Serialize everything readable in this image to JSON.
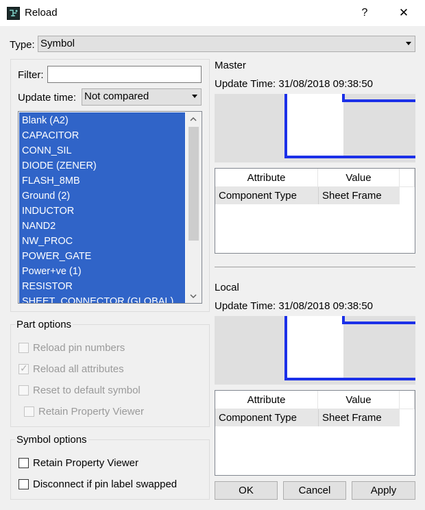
{
  "window": {
    "title": "Reload",
    "help": "?",
    "close": "✕"
  },
  "type": {
    "label": "Type:",
    "value": "Symbol"
  },
  "filter": {
    "label": "Filter:",
    "value": ""
  },
  "update_time": {
    "label": "Update time:",
    "value": "Not compared"
  },
  "symbols": [
    "Blank (A2)",
    "CAPACITOR",
    "CONN_SIL",
    "DIODE (ZENER)",
    "FLASH_8MB",
    "Ground (2)",
    "INDUCTOR",
    "NAND2",
    "NW_PROC",
    "POWER_GATE",
    "Power+ve (1)",
    "RESISTOR",
    "SHEET_CONNECTOR (GLOBAL)"
  ],
  "part_options": {
    "title": "Part options",
    "reload_pin_numbers": "Reload pin numbers",
    "reload_all_attributes": "Reload all attributes",
    "reset_default_symbol": "Reset to default symbol",
    "retain_property_viewer": "Retain Property Viewer"
  },
  "symbol_options": {
    "title": "Symbol options",
    "retain_property_viewer": "Retain Property Viewer",
    "disconnect_pin_label": "Disconnect if pin label swapped"
  },
  "master": {
    "heading": "Master",
    "update_time": "Update Time: 31/08/2018 09:38:50",
    "columns": [
      "Attribute",
      "Value"
    ],
    "rows": [
      {
        "attribute": "Component Type",
        "value": "Sheet Frame"
      }
    ]
  },
  "local": {
    "heading": "Local",
    "update_time": "Update Time: 31/08/2018 09:38:50",
    "columns": [
      "Attribute",
      "Value"
    ],
    "rows": [
      {
        "attribute": "Component Type",
        "value": "Sheet Frame"
      }
    ]
  },
  "buttons": {
    "ok": "OK",
    "cancel": "Cancel",
    "apply": "Apply"
  },
  "colors": {
    "selection": "#3064c8",
    "preview_line": "#1b30e8"
  }
}
